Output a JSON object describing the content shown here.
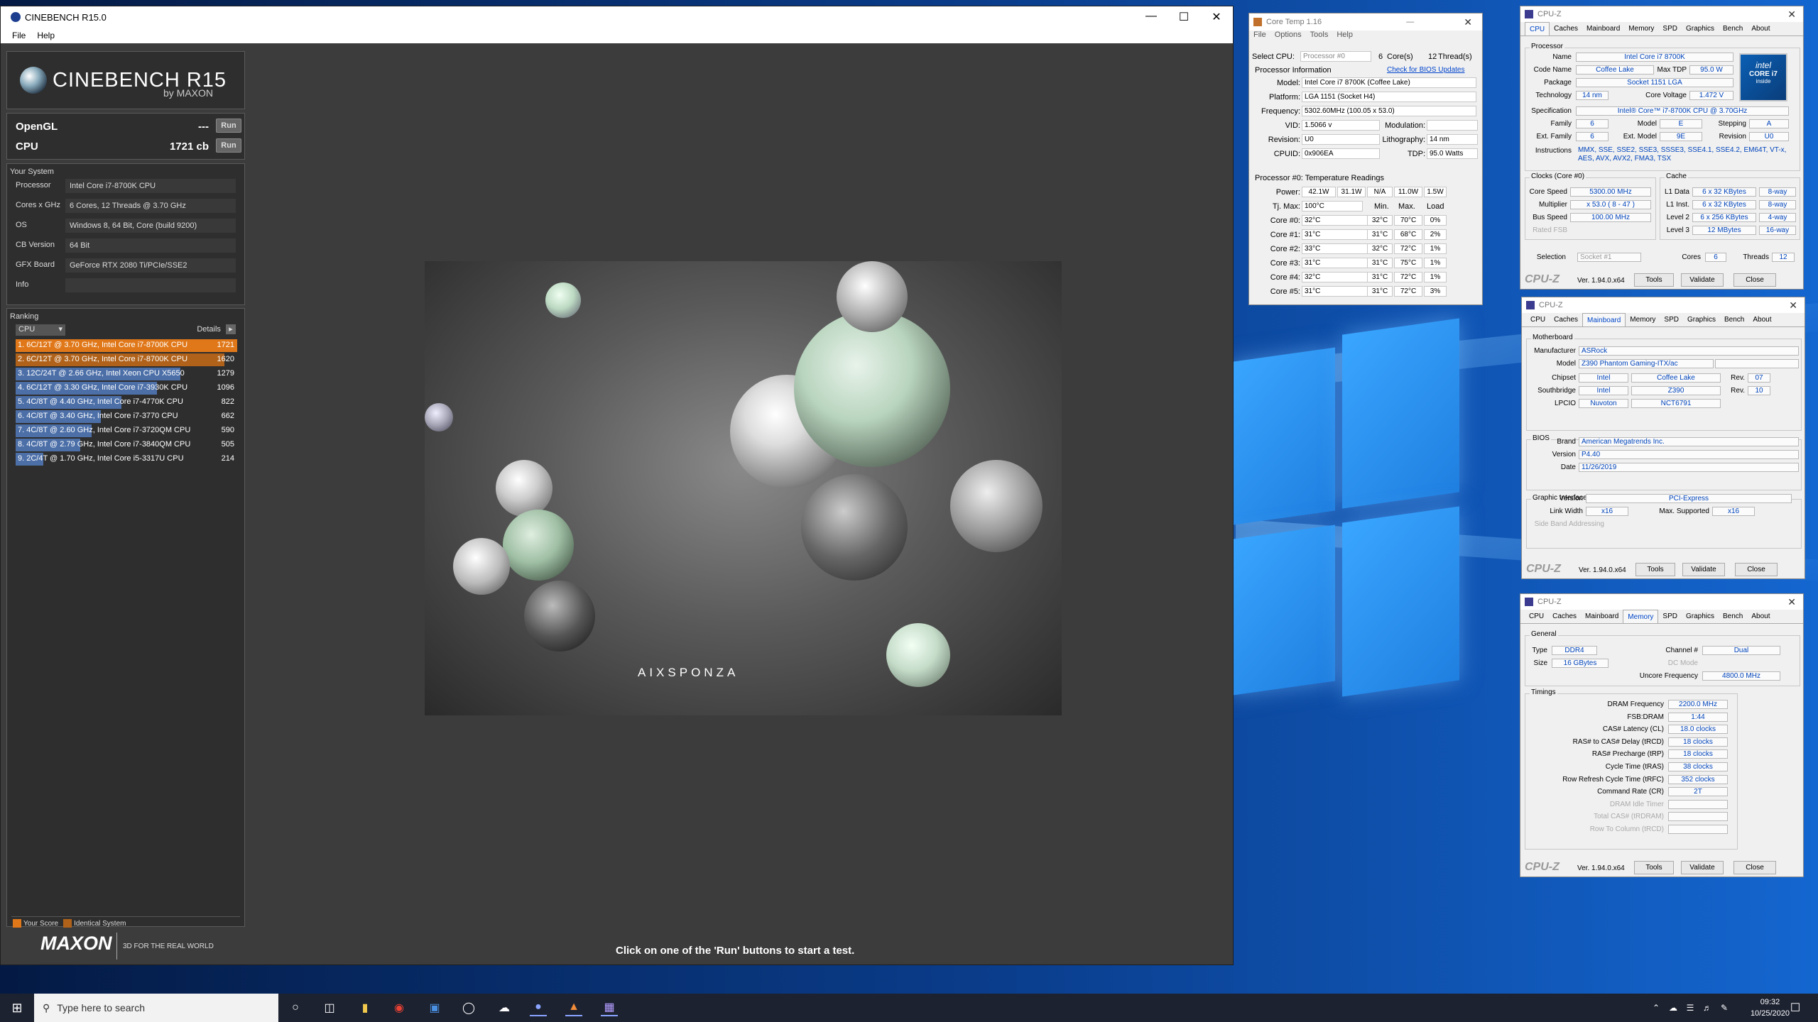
{
  "cinebench": {
    "title": "CINEBENCH R15.0",
    "menu": [
      "File",
      "Help"
    ],
    "logo_main": "CINEBENCH R15",
    "logo_sub": "by MAXON",
    "tests": [
      {
        "name": "OpenGL",
        "value": "---",
        "run": "Run"
      },
      {
        "name": "CPU",
        "value": "1721 cb",
        "run": "Run"
      }
    ],
    "system_header": "Your System",
    "system": [
      {
        "key": "Processor",
        "value": "Intel Core i7-8700K CPU"
      },
      {
        "key": "Cores x GHz",
        "value": "6 Cores, 12 Threads @ 3.70 GHz"
      },
      {
        "key": "OS",
        "value": "Windows 8, 64 Bit, Core (build 9200)"
      },
      {
        "key": "CB Version",
        "value": "64 Bit"
      },
      {
        "key": "GFX Board",
        "value": "GeForce RTX 2080 Ti/PCIe/SSE2"
      },
      {
        "key": "Info",
        "value": ""
      }
    ],
    "ranking_header": "Ranking",
    "ranking_select": "CPU",
    "details_label": "Details",
    "ranking": [
      {
        "label": "1. 6C/12T @ 3.70 GHz, Intel Core i7-8700K CPU",
        "score": 1721,
        "color": "#e0781a"
      },
      {
        "label": "2. 6C/12T @ 3.70 GHz, Intel Core i7-8700K CPU",
        "score": 1620,
        "color": "#b0621a"
      },
      {
        "label": "3. 12C/24T @ 2.66 GHz, Intel Xeon CPU X5650",
        "score": 1279,
        "color": "#4c6fa8"
      },
      {
        "label": "4. 6C/12T @ 3.30 GHz,  Intel Core i7-3930K CPU",
        "score": 1096,
        "color": "#4c6fa8"
      },
      {
        "label": "5. 4C/8T @ 4.40 GHz, Intel Core i7-4770K CPU",
        "score": 822,
        "color": "#4c6fa8"
      },
      {
        "label": "6. 4C/8T @ 3.40 GHz,  Intel Core i7-3770 CPU",
        "score": 662,
        "color": "#4c6fa8"
      },
      {
        "label": "7. 4C/8T @ 2.60 GHz, Intel Core i7-3720QM CPU",
        "score": 590,
        "color": "#4c6fa8"
      },
      {
        "label": "8. 4C/8T @ 2.79 GHz,  Intel Core i7-3840QM CPU",
        "score": 505,
        "color": "#4c6fa8"
      },
      {
        "label": "9. 2C/4T @ 1.70 GHz,  Intel Core i5-3317U CPU",
        "score": 214,
        "color": "#4c6fa8"
      }
    ],
    "legend": {
      "your_score": "Your Score",
      "identical": "Identical System"
    },
    "maxon": "MAXON",
    "maxon_tag": "3D FOR THE REAL WORLD",
    "render_watermark": "AIXSPONZA",
    "status": "Click on one of the 'Run' buttons to start a test."
  },
  "coretemp": {
    "title": "Core Temp 1.16",
    "menu": [
      "File",
      "Options",
      "Tools",
      "Help"
    ],
    "select_cpu_label": "Select CPU:",
    "select_cpu": "Processor #0",
    "cores": "6",
    "cores_label": "Core(s)",
    "threads": "12",
    "threads_label": "Thread(s)",
    "proc_info": "Processor Information",
    "bios_link": "Check for BIOS Updates",
    "model_label": "Model:",
    "model": "Intel Core i7 8700K (Coffee Lake)",
    "platform_label": "Platform:",
    "platform": "LGA 1151 (Socket H4)",
    "freq_label": "Frequency:",
    "freq": "5302.60MHz (100.05 x 53.0)",
    "vid_label": "VID:",
    "vid": "1.5066 v",
    "mod_label": "Modulation:",
    "mod": "",
    "rev_label": "Revision:",
    "rev": "U0",
    "litho_label": "Lithography:",
    "litho": "14 nm",
    "cpuid_label": "CPUID:",
    "cpuid": "0x906EA",
    "tdp_label": "TDP:",
    "tdp": "95.0 Watts",
    "temp_header": "Processor #0: Temperature Readings",
    "power_label": "Power:",
    "power": [
      "42.1W",
      "31.1W",
      "N/A",
      "11.0W",
      "1.5W"
    ],
    "tjmax_label": "Tj. Max:",
    "tjmax": "100°C",
    "min_label": "Min.",
    "max_label": "Max.",
    "load_label": "Load",
    "core_rows": [
      {
        "name": "Core #0:",
        "temp": "32°C",
        "min": "32°C",
        "max": "70°C",
        "load": "0%"
      },
      {
        "name": "Core #1:",
        "temp": "31°C",
        "min": "31°C",
        "max": "68°C",
        "load": "2%"
      },
      {
        "name": "Core #2:",
        "temp": "33°C",
        "min": "32°C",
        "max": "72°C",
        "load": "1%"
      },
      {
        "name": "Core #3:",
        "temp": "31°C",
        "min": "31°C",
        "max": "75°C",
        "load": "1%"
      },
      {
        "name": "Core #4:",
        "temp": "32°C",
        "min": "31°C",
        "max": "72°C",
        "load": "1%"
      },
      {
        "name": "Core #5:",
        "temp": "31°C",
        "min": "31°C",
        "max": "72°C",
        "load": "3%"
      }
    ]
  },
  "cpuz_cpu": {
    "title": "CPU-Z",
    "tabs": [
      "CPU",
      "Caches",
      "Mainboard",
      "Memory",
      "SPD",
      "Graphics",
      "Bench",
      "About"
    ],
    "processor_group": "Processor",
    "name_label": "Name",
    "name": "Intel Core i7 8700K",
    "codename_label": "Code Name",
    "codename": "Coffee Lake",
    "maxtdp_label": "Max TDP",
    "maxtdp": "95.0 W",
    "package_label": "Package",
    "package": "Socket 1151 LGA",
    "tech_label": "Technology",
    "tech": "14 nm",
    "cv_label": "Core Voltage",
    "cv": "1.472 V",
    "spec_label": "Specification",
    "spec": "Intel® Core™ i7-8700K CPU @ 3.70GHz",
    "family_label": "Family",
    "family": "6",
    "model_label": "Model",
    "model": "E",
    "stepping_label": "Stepping",
    "stepping": "A",
    "extfam_label": "Ext. Family",
    "extfam": "6",
    "extmod_label": "Ext. Model",
    "extmod": "9E",
    "revision_label": "Revision",
    "revision": "U0",
    "instr_label": "Instructions",
    "instr": "MMX, SSE, SSE2, SSE3, SSSE3, SSE4.1, SSE4.2, EM64T, VT-x, AES, AVX, AVX2, FMA3, TSX",
    "clocks_group": "Clocks (Core #0)",
    "cache_group": "Cache",
    "corespeed_label": "Core Speed",
    "corespeed": "5300.00 MHz",
    "mult_label": "Multiplier",
    "mult": "x 53.0 ( 8 - 47 )",
    "bus_label": "Bus Speed",
    "bus": "100.00 MHz",
    "fsb_label": "Rated FSB",
    "l1d_label": "L1 Data",
    "l1d": "6 x 32 KBytes",
    "l1d_w": "8-way",
    "l1i_label": "L1 Inst.",
    "l1i": "6 x 32 KBytes",
    "l1i_w": "8-way",
    "l2_label": "Level 2",
    "l2": "6 x 256 KBytes",
    "l2_w": "4-way",
    "l3_label": "Level 3",
    "l3": "12 MBytes",
    "l3_w": "16-way",
    "sel_label": "Selection",
    "sel": "Socket #1",
    "cores_label": "Cores",
    "cores": "6",
    "threads_label": "Threads",
    "threads": "12",
    "badge": [
      "intel",
      "CORE i7",
      "inside"
    ],
    "footer": {
      "brand": "CPU-Z",
      "ver": "Ver. 1.94.0.x64",
      "tools": "Tools",
      "validate": "Validate",
      "close": "Close"
    }
  },
  "cpuz_mb": {
    "title": "CPU-Z",
    "mb_group": "Motherboard",
    "mfr_label": "Manufacturer",
    "mfr": "ASRock",
    "model_label": "Model",
    "model": "Z390 Phantom Gaming-ITX/ac",
    "chipset_label": "Chipset",
    "chipset_v": "Intel",
    "chipset_n": "Coffee Lake",
    "rev_label": "Rev.",
    "chipset_rev": "07",
    "sb_label": "Southbridge",
    "sb_v": "Intel",
    "sb_n": "Z390",
    "sb_rev": "10",
    "lpcio_label": "LPCIO",
    "lpcio_v": "Nuvoton",
    "lpcio_n": "NCT6791",
    "bios_group": "BIOS",
    "brand_label": "Brand",
    "brand": "American Megatrends Inc.",
    "version_label": "Version",
    "version": "P4.40",
    "date_label": "Date",
    "date": "11/26/2019",
    "gi_group": "Graphic Interface",
    "gi_ver_label": "Version",
    "gi_ver": "PCI-Express",
    "lw_label": "Link Width",
    "lw": "x16",
    "ms_label": "Max. Supported",
    "ms": "x16",
    "sba_label": "Side Band Addressing"
  },
  "cpuz_mem": {
    "title": "CPU-Z",
    "general_group": "General",
    "type_label": "Type",
    "type": "DDR4",
    "channel_label": "Channel #",
    "channel": "Dual",
    "size_label": "Size",
    "size": "16 GBytes",
    "dc_label": "DC Mode",
    "uncore_label": "Uncore Frequency",
    "uncore": "4800.0 MHz",
    "timings_group": "Timings",
    "timings": [
      {
        "label": "DRAM Frequency",
        "value": "2200.0 MHz"
      },
      {
        "label": "FSB:DRAM",
        "value": "1:44"
      },
      {
        "label": "CAS# Latency (CL)",
        "value": "18.0 clocks"
      },
      {
        "label": "RAS# to CAS# Delay (tRCD)",
        "value": "18 clocks"
      },
      {
        "label": "RAS# Precharge (tRP)",
        "value": "18 clocks"
      },
      {
        "label": "Cycle Time (tRAS)",
        "value": "38 clocks"
      },
      {
        "label": "Row Refresh Cycle Time (tRFC)",
        "value": "352 clocks"
      },
      {
        "label": "Command Rate (CR)",
        "value": "2T"
      },
      {
        "label": "DRAM Idle Timer",
        "value": ""
      },
      {
        "label": "Total CAS# (tRDRAM)",
        "value": ""
      },
      {
        "label": "Row To Column (tRCD)",
        "value": ""
      }
    ]
  },
  "taskbar": {
    "search_placeholder": "Type here to search",
    "time": "09:32",
    "date": "10/25/2020"
  }
}
